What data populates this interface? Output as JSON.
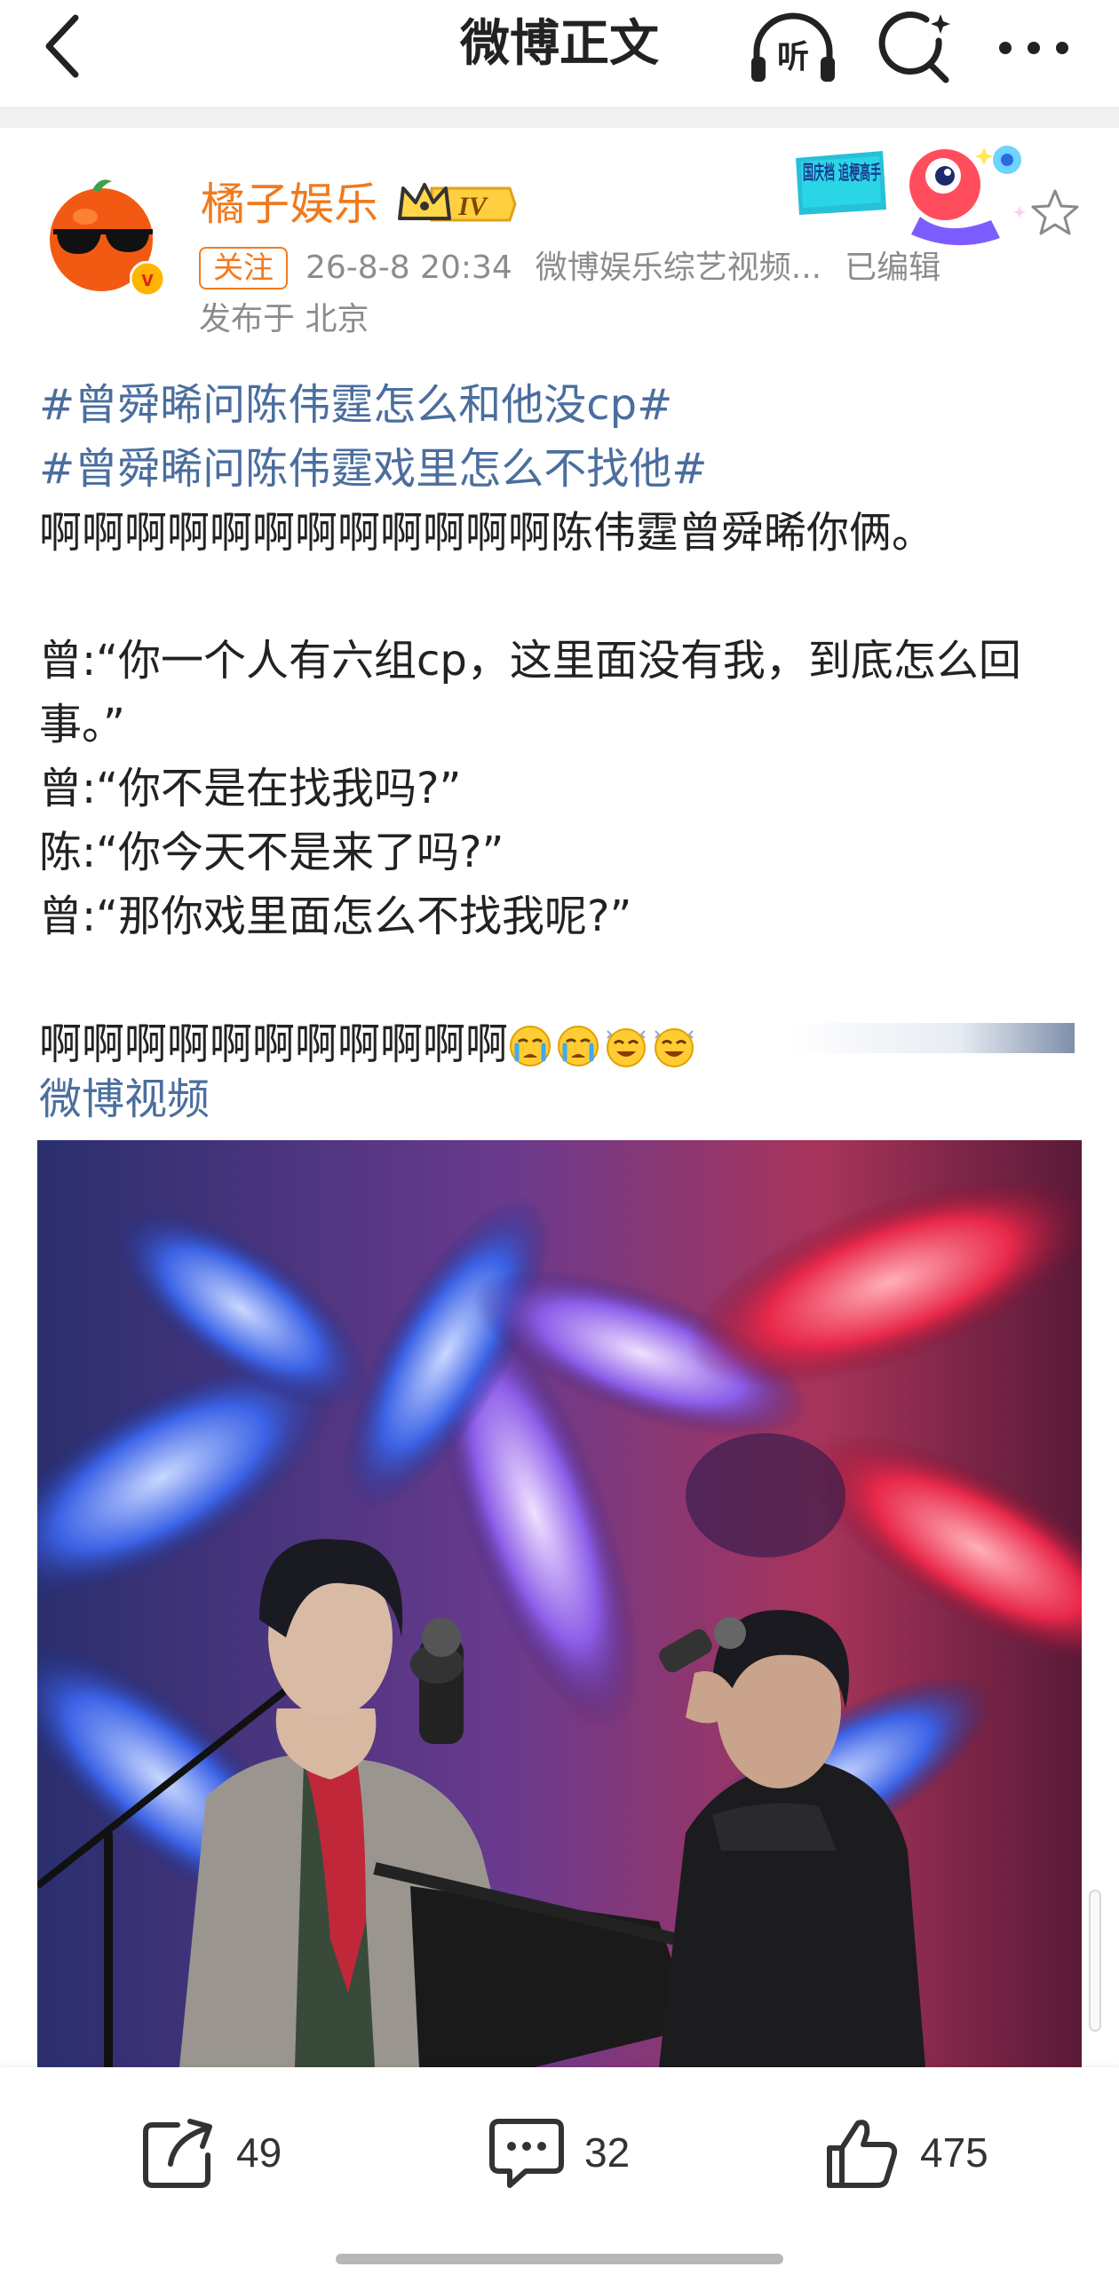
{
  "header": {
    "title": "微博正文",
    "listen_label": "听"
  },
  "author": {
    "name": "橘子娱乐",
    "vip_level": "IV",
    "follow_label": "关注",
    "timestamp": "26-8-8 20:34",
    "source": "微博娱乐综艺视频...",
    "edited": "已编辑",
    "location": "发布于 北京",
    "badge_text": "国庆档 追梗高手",
    "verified_mark": "v"
  },
  "post": {
    "topic1": "#曾舜晞问陈伟霆怎么和他没cp#",
    "topic2": "#曾舜晞问陈伟霆戏里怎么不找他#",
    "line1": "啊啊啊啊啊啊啊啊啊啊啊啊陈伟霆曾舜晞你俩。",
    "line2": "曾:“你一个人有六组cp，这里面没有我，到底怎么回事。”",
    "line3": "曾:“你不是在找我吗?”",
    "line4": "陈:“你今天不是来了吗?”",
    "line5": "曾:“那你戏里面怎么不找我呢?”",
    "line6": "啊啊啊啊啊啊啊啊啊啊啊",
    "emojis": [
      "crying-emoji",
      "crying-emoji",
      "happy-emoji",
      "happy-emoji"
    ],
    "video_link": "微博视频"
  },
  "actions": {
    "repost_count": "49",
    "comment_count": "32",
    "like_count": "475"
  },
  "colors": {
    "accent": "#f07a1e",
    "link": "#4a6e9e",
    "meta": "#8c8c8c"
  }
}
